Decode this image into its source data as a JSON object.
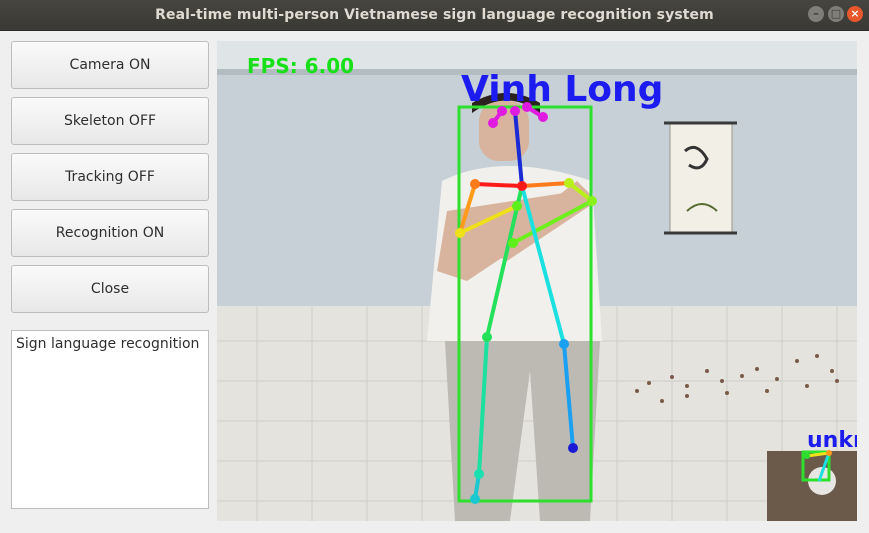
{
  "window": {
    "title": "Real-time multi-person Vietnamese sign language recognition system"
  },
  "controls": {
    "camera_label": "Camera ON",
    "skeleton_label": "Skeleton OFF",
    "tracking_label": "Tracking OFF",
    "recognition_label": "Recognition ON",
    "close_label": "Close"
  },
  "output_panel": {
    "text": "Sign language recognition"
  },
  "video": {
    "fps_text": "FPS: 6.00",
    "person_label": "Vinh Long",
    "second_person_label": "unkr",
    "colors": {
      "fps": "#18e018",
      "label": "#1c1cf0",
      "box": "#2ee02e"
    }
  },
  "icons": [
    "minimize-icon",
    "maximize-icon",
    "close-icon"
  ]
}
